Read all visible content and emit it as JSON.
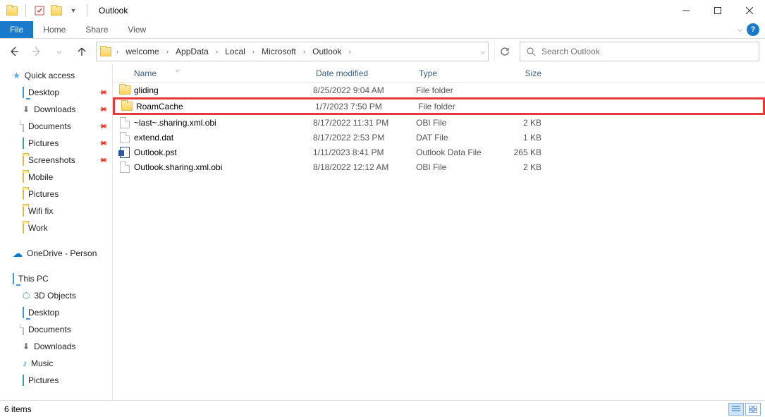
{
  "window": {
    "title": "Outlook"
  },
  "ribbon": {
    "file": "File",
    "tabs": [
      "Home",
      "Share",
      "View"
    ]
  },
  "breadcrumbs": [
    "welcome",
    "AppData",
    "Local",
    "Microsoft",
    "Outlook"
  ],
  "search": {
    "placeholder": "Search Outlook"
  },
  "sidebar": {
    "quick_access": "Quick access",
    "quick_items": [
      {
        "label": "Desktop",
        "icon": "monitor",
        "pinned": true
      },
      {
        "label": "Downloads",
        "icon": "dl",
        "pinned": true
      },
      {
        "label": "Documents",
        "icon": "file",
        "pinned": true
      },
      {
        "label": "Pictures",
        "icon": "pic",
        "pinned": true
      },
      {
        "label": "Screenshots",
        "icon": "folder",
        "pinned": true
      },
      {
        "label": "Mobile",
        "icon": "folder",
        "pinned": false
      },
      {
        "label": "Pictures",
        "icon": "folder",
        "pinned": false
      },
      {
        "label": "Wifi fix",
        "icon": "folder",
        "pinned": false
      },
      {
        "label": "Work",
        "icon": "folder",
        "pinned": false
      }
    ],
    "onedrive": "OneDrive - Person",
    "this_pc": "This PC",
    "pc_items": [
      {
        "label": "3D Objects",
        "icon": "obj3d"
      },
      {
        "label": "Desktop",
        "icon": "monitor"
      },
      {
        "label": "Documents",
        "icon": "file"
      },
      {
        "label": "Downloads",
        "icon": "dl"
      },
      {
        "label": "Music",
        "icon": "music"
      },
      {
        "label": "Pictures",
        "icon": "pic"
      }
    ]
  },
  "columns": {
    "name": "Name",
    "date": "Date modified",
    "type": "Type",
    "size": "Size"
  },
  "files": [
    {
      "icon": "folder",
      "name": "gliding",
      "date": "8/25/2022 9:04 AM",
      "type": "File folder",
      "size": "",
      "highlight": false
    },
    {
      "icon": "folder",
      "name": "RoamCache",
      "date": "1/7/2023 7:50 PM",
      "type": "File folder",
      "size": "",
      "highlight": true
    },
    {
      "icon": "file",
      "name": "~last~.sharing.xml.obi",
      "date": "8/17/2022 11:31 PM",
      "type": "OBI File",
      "size": "2 KB",
      "highlight": false
    },
    {
      "icon": "file",
      "name": "extend.dat",
      "date": "8/17/2022 2:53 PM",
      "type": "DAT File",
      "size": "1 KB",
      "highlight": false
    },
    {
      "icon": "pst",
      "name": "Outlook.pst",
      "date": "1/11/2023 8:41 PM",
      "type": "Outlook Data File",
      "size": "265 KB",
      "highlight": false
    },
    {
      "icon": "file",
      "name": "Outlook.sharing.xml.obi",
      "date": "8/18/2022 12:12 AM",
      "type": "OBI File",
      "size": "2 KB",
      "highlight": false
    }
  ],
  "status": {
    "count": "6 items"
  }
}
